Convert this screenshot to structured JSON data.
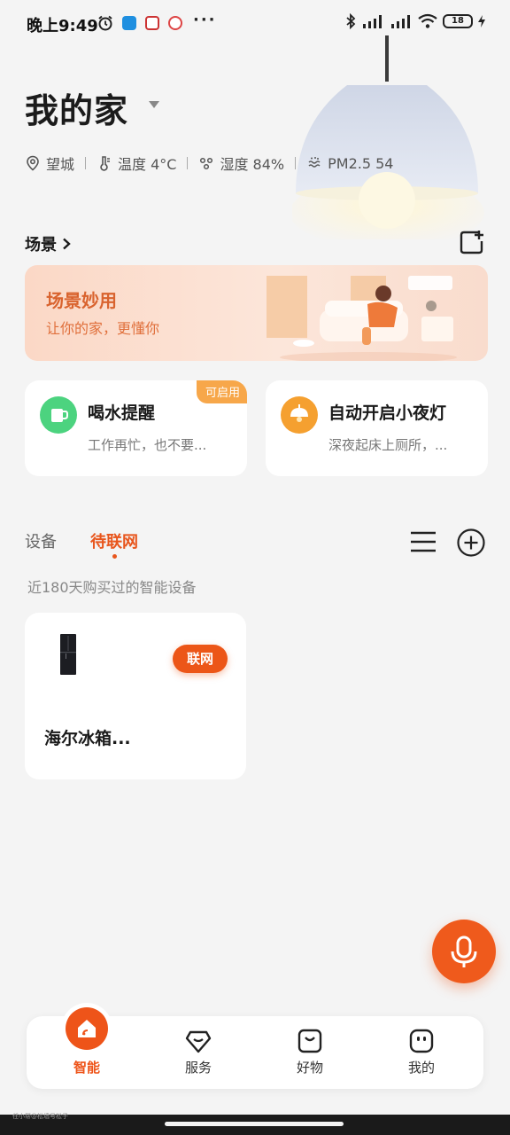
{
  "status_bar": {
    "time": "晚上9:49",
    "more": "···",
    "battery": "18"
  },
  "header": {
    "title": "我的家",
    "location": "望城",
    "temperature": "温度 4°C",
    "humidity": "湿度 84%",
    "pm25": "PM2.5 54"
  },
  "scene": {
    "label": "场景",
    "banner_title": "场景妙用",
    "banner_subtitle": "让你的家，更懂你"
  },
  "automations": [
    {
      "title": "喝水提醒",
      "desc": "工作再忙，也不要...",
      "tag": "可启用",
      "icon": "cup-icon",
      "color": "#4cd37f"
    },
    {
      "title": "自动开启小夜灯",
      "desc": "深夜起床上厕所，...",
      "icon": "night-lamp-icon",
      "color": "#f5a030"
    }
  ],
  "devices": {
    "tab_device": "设备",
    "tab_pending": "待联网",
    "recent_label": "近180天购买过的智能设备",
    "items": [
      {
        "name": "海尔冰箱...",
        "action": "联网"
      }
    ]
  },
  "bottom_nav": [
    {
      "label": "智能",
      "icon": "smart-home-icon",
      "active": true
    },
    {
      "label": "服务",
      "icon": "diamond-icon",
      "active": false
    },
    {
      "label": "好物",
      "icon": "shopping-bag-icon",
      "active": false
    },
    {
      "label": "我的",
      "icon": "profile-face-icon",
      "active": false
    }
  ],
  "watermark": "任小帮@松墙号松子",
  "colors": {
    "accent": "#ec5618",
    "banner_text": "#d9632e",
    "background": "#f4f4f4"
  }
}
